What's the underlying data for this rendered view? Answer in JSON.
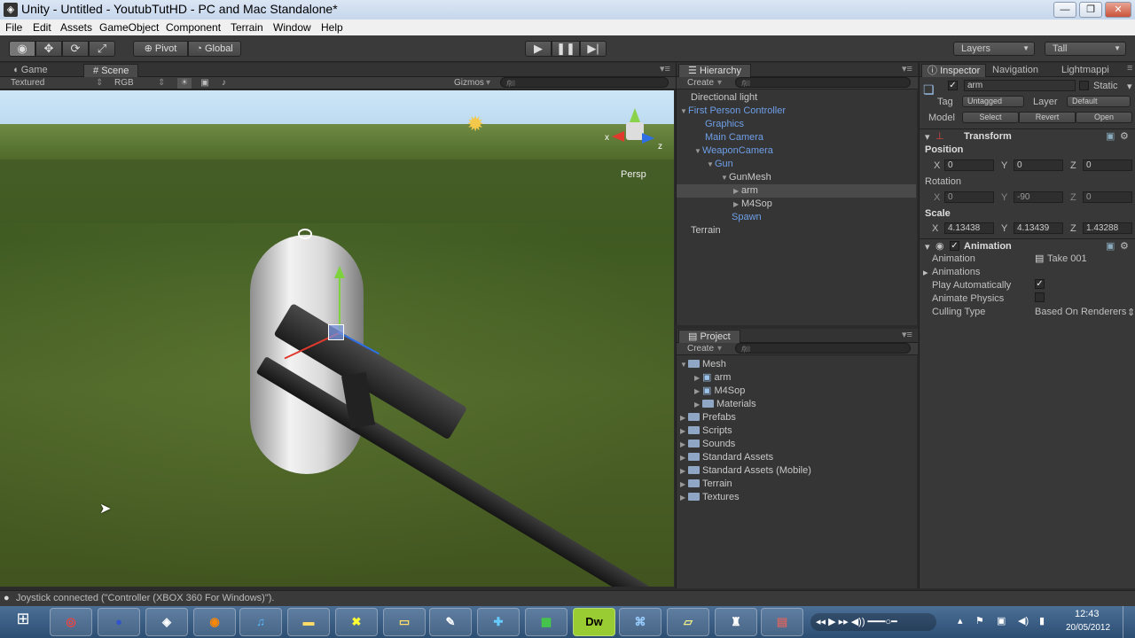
{
  "window": {
    "title": "Unity - Untitled - YoutubTutHD - PC and Mac Standalone*",
    "minimize": "—",
    "maximize": "❐",
    "close": "✕"
  },
  "menu": [
    "File",
    "Edit",
    "Assets",
    "GameObject",
    "Component",
    "Terrain",
    "Window",
    "Help"
  ],
  "toolbar": {
    "pivot": "Pivot",
    "global": "Global",
    "layers": "Layers",
    "layout": "Tall"
  },
  "scene_panel": {
    "tab_game": "Game",
    "tab_scene": "Scene",
    "render_mode": "Textured",
    "color_mode": "RGB",
    "gizmos": "Gizmos",
    "search_placeholder": "All",
    "persp_label": "Persp",
    "gizmo_x": "x",
    "gizmo_z": "z"
  },
  "hierarchy": {
    "tab": "Hierarchy",
    "create": "Create",
    "search_placeholder": "All",
    "items": [
      {
        "label": "Directional light",
        "color": "#c8c8c8"
      },
      {
        "label": "First Person Controller",
        "color": "#6e9fe8"
      },
      {
        "label": "Graphics",
        "color": "#6e9fe8"
      },
      {
        "label": "Main Camera",
        "color": "#6e9fe8"
      },
      {
        "label": "WeaponCamera",
        "color": "#6e9fe8"
      },
      {
        "label": "Gun",
        "color": "#6e9fe8"
      },
      {
        "label": "GunMesh",
        "color": "#c8c8c8"
      },
      {
        "label": "arm",
        "color": "#c8c8c8"
      },
      {
        "label": "M4Sop",
        "color": "#c8c8c8"
      },
      {
        "label": "Spawn",
        "color": "#6e9fe8"
      },
      {
        "label": "Terrain",
        "color": "#c8c8c8"
      }
    ]
  },
  "project": {
    "tab": "Project",
    "create": "Create",
    "search_placeholder": "All",
    "items": [
      {
        "label": "Mesh"
      },
      {
        "label": "arm"
      },
      {
        "label": "M4Sop"
      },
      {
        "label": "Materials"
      },
      {
        "label": "Prefabs"
      },
      {
        "label": "Scripts"
      },
      {
        "label": "Sounds"
      },
      {
        "label": "Standard Assets"
      },
      {
        "label": "Standard Assets (Mobile)"
      },
      {
        "label": "Terrain"
      },
      {
        "label": "Textures"
      }
    ]
  },
  "inspector": {
    "tab_inspector": "Inspector",
    "tab_navigation": "Navigation",
    "tab_lightmapping": "Lightmappi",
    "object_name": "arm",
    "static": "Static",
    "tag_label": "Tag",
    "tag_value": "Untagged",
    "layer_label": "Layer",
    "layer_value": "Default",
    "model_label": "Model",
    "select": "Select",
    "revert": "Revert",
    "open": "Open",
    "transform": {
      "title": "Transform",
      "position_label": "Position",
      "position": {
        "x": "0",
        "y": "0",
        "z": "0"
      },
      "rotation_label": "Rotation",
      "rotation": {
        "x": "0",
        "y": "-90",
        "z": "0"
      },
      "scale_label": "Scale",
      "scale": {
        "x": "4.13438",
        "y": "4.13439",
        "z": "1.43288"
      }
    },
    "animation": {
      "title": "Animation",
      "animation_label": "Animation",
      "animation_value": "Take 001",
      "animations_label": "Animations",
      "play_auto_label": "Play Automatically",
      "play_auto": true,
      "animate_physics_label": "Animate Physics",
      "animate_physics": false,
      "culling_label": "Culling Type",
      "culling_value": "Based On Renderers"
    }
  },
  "status": "Joystick connected (\"Controller (XBOX 360 For Windows)\").",
  "taskbar": {
    "apps": [
      "chrome-icon",
      "eclipse-icon",
      "unity-icon",
      "firefox-icon",
      "itunes-icon",
      "folder-icon",
      "xbox-icon",
      "explorer-icon",
      "paint-icon",
      "puzzle-icon",
      "excel-icon",
      "Dw",
      "network-icon",
      "notes-icon",
      "steam-icon",
      "winrar-icon"
    ],
    "clock_time": "12:43",
    "clock_date": "20/05/2012"
  },
  "colors": {
    "hierarchy_blue": "#6e9fe8",
    "sky": "#cde6f7",
    "grass": "#4b6428"
  }
}
